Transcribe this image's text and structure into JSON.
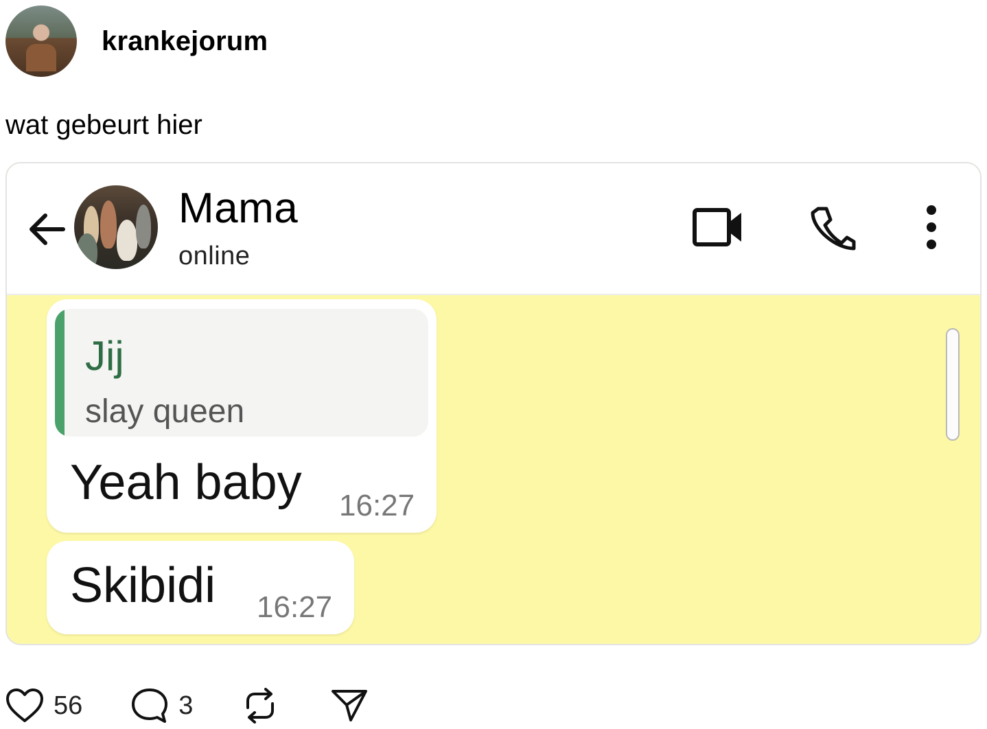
{
  "post": {
    "username": "krankejorum",
    "caption": "wat gebeurt hier",
    "likes": "56",
    "comments": "3"
  },
  "chat": {
    "contact_name": "Mama",
    "contact_status": "online",
    "background_color": "#fdf8a6",
    "accent_color": "#4aa26a",
    "messages": [
      {
        "quote_author": "Jij",
        "quote_text": "slay queen",
        "text": "Yeah baby",
        "time": "16:27"
      },
      {
        "text": "Skibidi",
        "time": "16:27"
      }
    ]
  },
  "icons": {
    "back": "arrow-left-icon",
    "video": "video-camera-icon",
    "phone": "phone-icon",
    "more": "more-vertical-icon",
    "like": "heart-icon",
    "comment": "comment-bubble-icon",
    "repost": "repost-icon",
    "share": "send-icon"
  }
}
